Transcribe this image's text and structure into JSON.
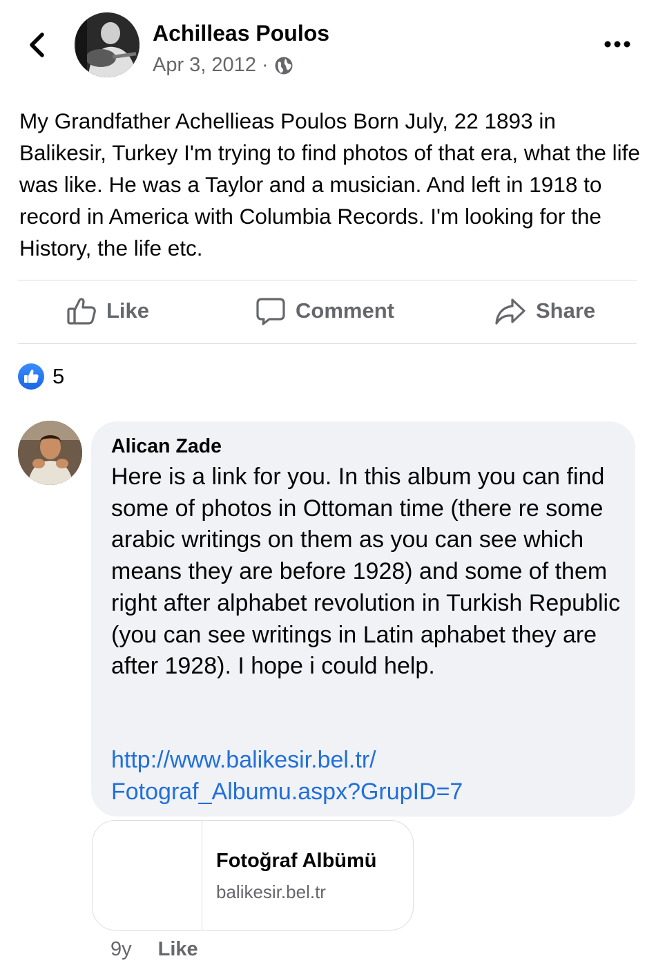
{
  "post": {
    "author": "Achilleas Poulos",
    "date": "Apr 3, 2012",
    "separator": "·",
    "body": "My Grandfather Achellieas Poulos Born July, 22 1893 in Balikesir, Turkey I'm trying to find photos of that era, what the life was like. He was a Taylor and a musician. And left in 1918 to record in America with Columbia Records. I'm looking for the History, the life etc."
  },
  "actions": {
    "like": "Like",
    "comment": "Comment",
    "share": "Share"
  },
  "reactions": {
    "count": "5"
  },
  "comment": {
    "author": "Alican Zade",
    "text": "Here is a link for you. In this album you can find some of photos in Ottoman time (there re some arabic writings on them as you can see which means they are before 1928) and some of them right after alphabet revolution in Turkish Republic (you can see writings in Latin aphabet they are after 1928). I hope i could help.",
    "link_line1": "http://www.balikesir.bel.tr/",
    "link_line2": "Fotograf_Albumu.aspx?GrupID=7",
    "preview": {
      "title": "Fotoğraf Albümü",
      "domain": "balikesir.bel.tr"
    },
    "time": "9y",
    "like_label": "Like"
  },
  "icons": {
    "back": "chevron-left-icon",
    "more": "more-horizontal-icon",
    "privacy": "globe-icon",
    "like": "thumbs-up-icon",
    "comment": "speech-bubble-icon",
    "share": "share-arrow-icon"
  },
  "colors": {
    "text": "#050505",
    "secondary": "#65676b",
    "link": "#216fdb",
    "bubble": "#f0f2f5",
    "like_blue": "#1a66e6",
    "divider": "#dadde1"
  }
}
